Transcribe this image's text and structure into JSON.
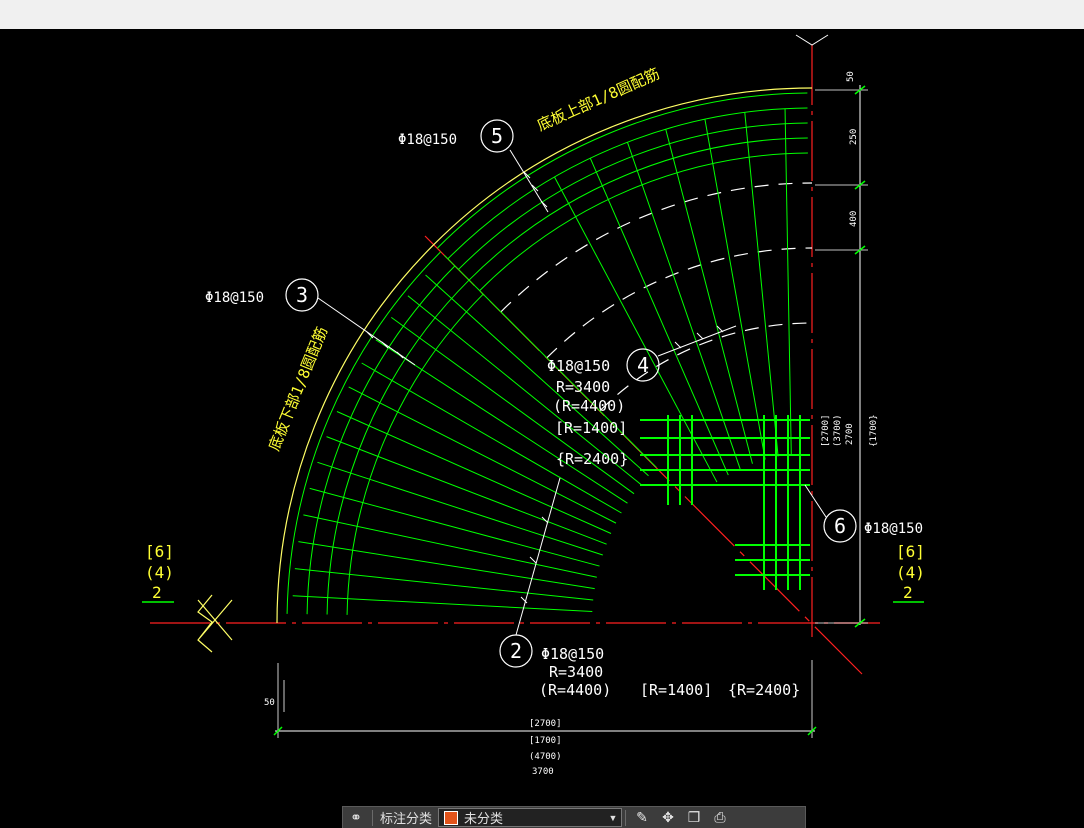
{
  "colors": {
    "background": "#000000",
    "rebar": "#00ff00",
    "outline": "#ffff66",
    "axis": "#ff2020",
    "text": "#ffffff",
    "yellow_text": "#ffff00"
  },
  "drawing": {
    "title_top": "底板上部1/8圆配筋",
    "title_bottom": "底板下部1/8圆配筋",
    "callout_5": {
      "number": "5",
      "spec": "Φ18@150"
    },
    "callout_3": {
      "number": "3",
      "spec": "Φ18@150"
    },
    "callout_4": {
      "number": "4",
      "spec_lines": [
        "Φ18@150",
        "R=3400",
        "(R=4400)",
        "[R=1400]",
        "{R=2400}"
      ]
    },
    "callout_2": {
      "number": "2",
      "spec_lines": [
        "Φ18@150",
        "R=3400",
        "(R=4400)",
        "[R=1400]",
        "{R=2400}"
      ]
    },
    "callout_6": {
      "number": "6",
      "spec": "Φ18@150"
    },
    "section_left": [
      "[6]",
      "(4)",
      "2"
    ],
    "section_right": [
      "[6]",
      "(4)",
      "2"
    ],
    "right_dims": [
      "50",
      "250",
      "400"
    ],
    "right_dim_stack": [
      "[2700]",
      "(3700)",
      "2700",
      "{1700}"
    ],
    "bottom_dim_small": "50",
    "bottom_dim_stack": [
      "[2700]",
      "[1700]",
      "(4700)",
      "3700"
    ]
  },
  "toolbar": {
    "icon_a": "pair-icon",
    "label": "标注分类",
    "select_value": "未分类",
    "icons": [
      "edit-icon",
      "move-icon",
      "copy-icon",
      "print-icon"
    ]
  }
}
